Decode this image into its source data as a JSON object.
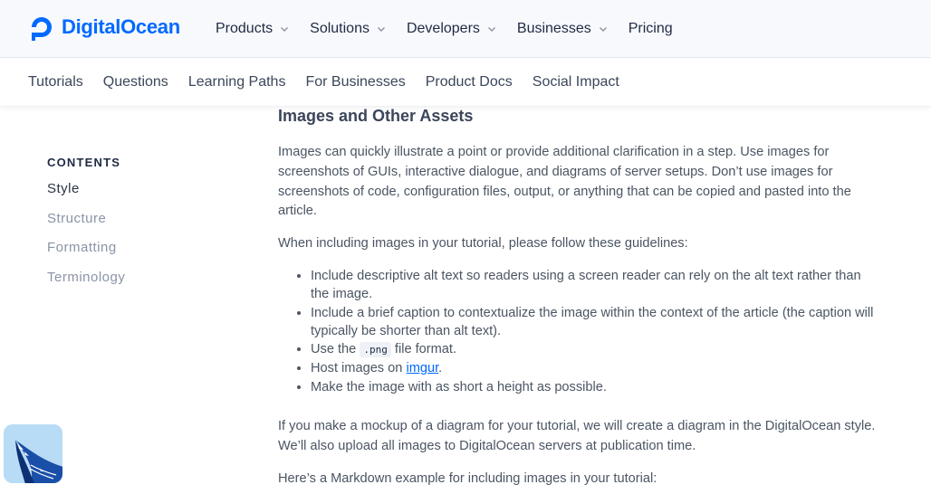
{
  "brand": {
    "name": "DigitalOcean",
    "color": "#0069ff"
  },
  "nav": [
    {
      "label": "Products",
      "has_dropdown": true
    },
    {
      "label": "Solutions",
      "has_dropdown": true
    },
    {
      "label": "Developers",
      "has_dropdown": true
    },
    {
      "label": "Businesses",
      "has_dropdown": true
    },
    {
      "label": "Pricing",
      "has_dropdown": false
    }
  ],
  "subnav": [
    "Tutorials",
    "Questions",
    "Learning Paths",
    "For Businesses",
    "Product Docs",
    "Social Impact"
  ],
  "toc": {
    "heading": "CONTENTS",
    "items": [
      "Style",
      "Structure",
      "Formatting",
      "Terminology"
    ],
    "active_index": 0
  },
  "article": {
    "heading": "Images and Other Assets",
    "para1": "Images can quickly illustrate a point or provide additional clarification in a step. Use images for screenshots of GUIs, interactive dialogue, and diagrams of server setups. Don’t use images for screenshots of code, configuration files, output, or anything that can be copied and pasted into the article.",
    "para2": "When including images in your tutorial, please follow these guidelines:",
    "guidelines": {
      "g1": "Include descriptive alt text so readers using a screen reader can rely on the alt text rather than the image.",
      "g2": "Include a brief caption to contextualize the image within the context of the article (the caption will typically be shorter than alt text).",
      "g3_before": "Use the ",
      "g3_code": ".png",
      "g3_after": " file format.",
      "g4_before": "Host images on ",
      "g4_link": "imgur",
      "g4_after": ".",
      "g5": "Make the image with as short a height as possible."
    },
    "para3": "If you make a mockup of a diagram for your tutorial, we will create a diagram in the DigitalOcean style. We’ll also upload all images to DigitalOcean servers at publication time.",
    "para4": "Here’s a Markdown example for including images in your tutorial:"
  },
  "widget": {
    "icon": "sammy-shark-icon",
    "background": "#b8dcf6"
  }
}
